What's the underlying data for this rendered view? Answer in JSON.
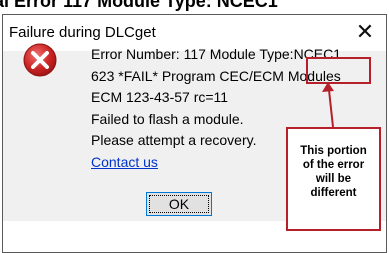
{
  "caption": "al Error 117 Module Type: NCEC1",
  "dialog": {
    "title": "Failure during DLCget",
    "close_glyph": "✕",
    "icon": "error-circle-x-icon",
    "message_lines": [
      "Error Number: 117 Module Type:NCEC1",
      "623 *FAIL* Program CEC/ECM Modules",
      "ECM 123-43-57 rc=11",
      "Failed to flash a module.",
      "Please attempt a recovery."
    ],
    "link": "Contact us",
    "ok_label": "OK"
  },
  "annotation": {
    "lines": [
      "This portion",
      "of the error",
      "will be",
      "different"
    ],
    "accent_color": "#b5202a"
  }
}
